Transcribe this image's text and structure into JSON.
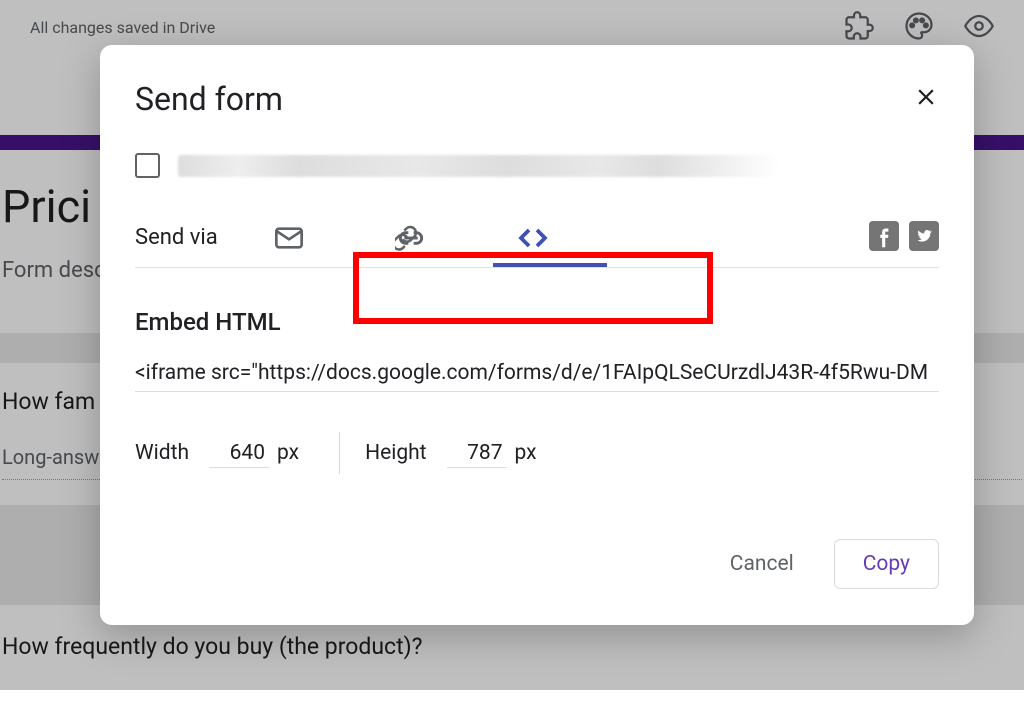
{
  "header": {
    "save_status": "All changes saved in Drive"
  },
  "form": {
    "title": "Prici",
    "description_label": "Form desc",
    "questions": [
      {
        "text": "How fam",
        "answer_type": "Long-answ"
      },
      {
        "text": "How frequently do you buy (the product)?",
        "answer_type": ""
      }
    ]
  },
  "modal": {
    "title": "Send form",
    "send_via_label": "Send via",
    "section_title": "Embed HTML",
    "embed_code": "<iframe src=\"https://docs.google.com/forms/d/e/1FAIpQLSeCUrzdlJ43R-4f5Rwu-DM",
    "width_label": "Width",
    "width_value": "640",
    "width_unit": "px",
    "height_label": "Height",
    "height_value": "787",
    "height_unit": "px",
    "cancel_label": "Cancel",
    "copy_label": "Copy"
  },
  "icons": {
    "puzzle": "puzzle-icon",
    "palette": "palette-icon",
    "preview": "preview-icon",
    "email": "email-icon",
    "link": "link-icon",
    "embed": "embed-icon",
    "facebook": "facebook-icon",
    "twitter": "twitter-icon",
    "close": "close-icon"
  }
}
